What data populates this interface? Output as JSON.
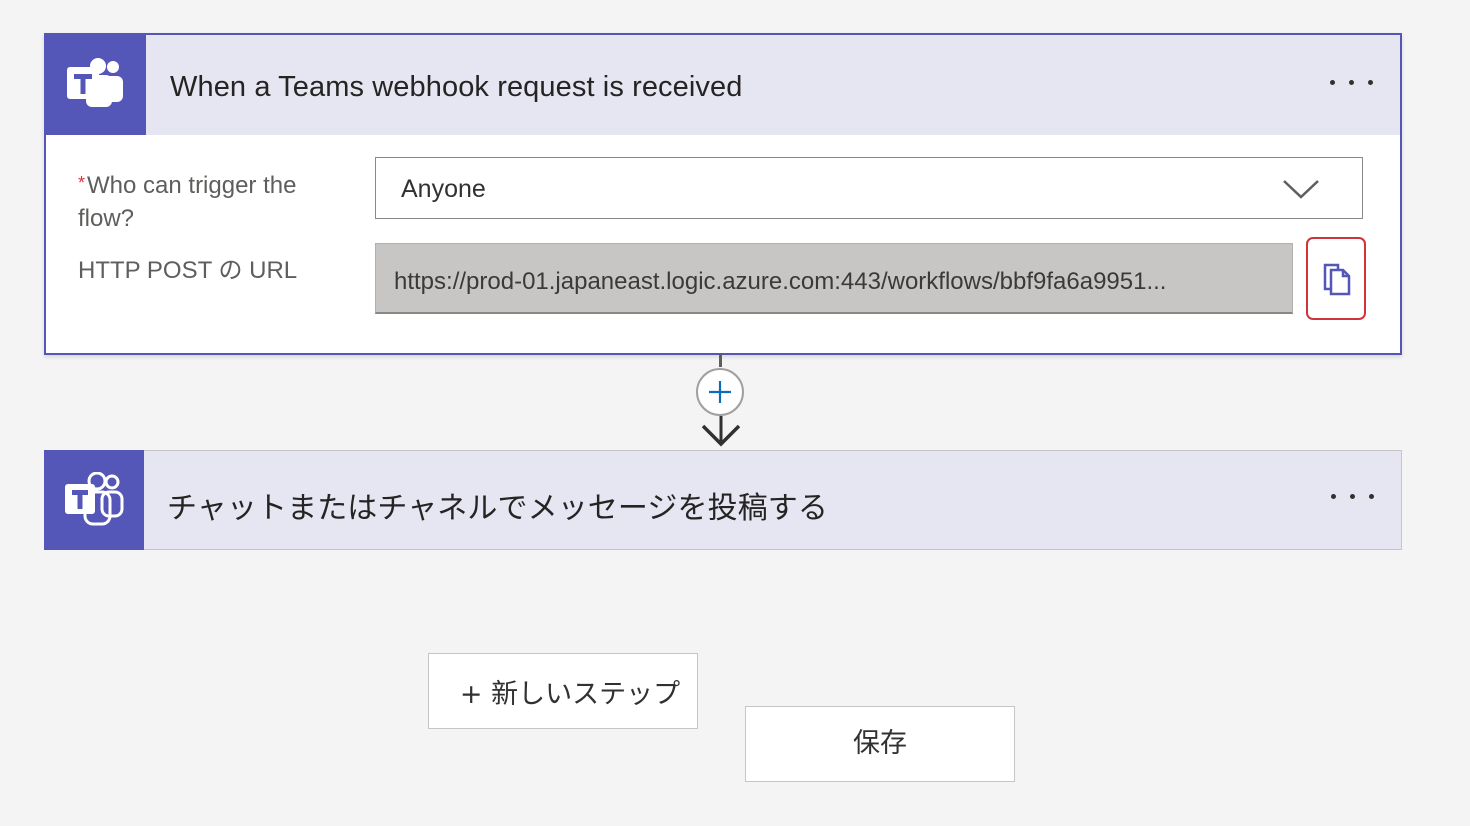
{
  "trigger_card": {
    "title": "When a Teams webhook request is received",
    "icon": "teams-icon",
    "more_icon": "more-horizontal-icon",
    "fields": {
      "who_can_trigger": {
        "required_marker": "*",
        "label": "Who can trigger the flow?",
        "value": "Anyone"
      },
      "http_post_url": {
        "label": "HTTP POST の URL",
        "value": "https://prod-01.japaneast.logic.azure.com:443/workflows/bbf9fa6a9951..."
      }
    },
    "copy_icon": "copy-icon"
  },
  "connector": {
    "add_icon": "plus-icon",
    "arrow_icon": "arrow-down-icon"
  },
  "action_card": {
    "title": "チャットまたはチャネルでメッセージを投稿する",
    "icon": "teams-icon",
    "more_icon": "more-horizontal-icon"
  },
  "buttons": {
    "new_step": "+ 新しいステップ",
    "save": "保存"
  },
  "colors": {
    "teams_purple": "#5457b8",
    "header_bg": "#e6e6f3",
    "required": "#e0313d",
    "highlight_border": "#d13438"
  }
}
